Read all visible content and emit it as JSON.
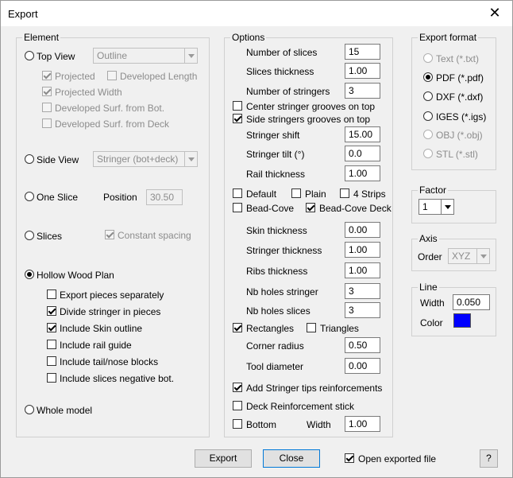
{
  "window": {
    "title": "Export",
    "close_glyph": "✕"
  },
  "element": {
    "legend": "Element",
    "top_view": {
      "label": "Top View",
      "selected": false,
      "combo_value": "Outline",
      "options": [
        {
          "label": "Projected",
          "checked": true
        },
        {
          "label": "Developed Length",
          "checked": false
        },
        {
          "label": "Projected Width",
          "checked": true
        },
        {
          "label": "Developed Surf. from Bot.",
          "checked": false
        },
        {
          "label": "Developed Surf. from Deck",
          "checked": false
        }
      ]
    },
    "side_view": {
      "label": "Side View",
      "selected": false,
      "combo_value": "Stringer (bot+deck)"
    },
    "one_slice": {
      "label": "One Slice",
      "selected": false,
      "position_label": "Position",
      "position_value": "30.50"
    },
    "slices": {
      "label": "Slices",
      "selected": false,
      "constant_spacing_label": "Constant spacing",
      "constant_spacing_checked": true
    },
    "hollow_wood_plan": {
      "label": "Hollow Wood Plan",
      "selected": true,
      "options": [
        {
          "label": "Export pieces separately",
          "checked": false
        },
        {
          "label": "Divide stringer in pieces",
          "checked": true
        },
        {
          "label": "Include Skin outline",
          "checked": true
        },
        {
          "label": "Include rail guide",
          "checked": false
        },
        {
          "label": "Include tail/nose blocks",
          "checked": false
        },
        {
          "label": "Include slices negative bot.",
          "checked": false
        }
      ]
    },
    "whole_model": {
      "label": "Whole model",
      "selected": false
    }
  },
  "options": {
    "legend": "Options",
    "number_of_slices": {
      "label": "Number of slices",
      "value": "15"
    },
    "slices_thickness": {
      "label": "Slices thickness",
      "value": "1.00"
    },
    "number_of_stringers": {
      "label": "Number of stringers",
      "value": "3"
    },
    "center_stringer_grooves": {
      "label": "Center stringer grooves on top",
      "checked": false
    },
    "side_stringers_grooves": {
      "label": "Side stringers grooves on top",
      "checked": true
    },
    "stringer_shift": {
      "label": "Stringer shift",
      "value": "15.00"
    },
    "stringer_tilt": {
      "label": "Stringer tilt (°)",
      "value": "0.0"
    },
    "rail_thickness": {
      "label": "Rail thickness",
      "value": "1.00"
    },
    "default": {
      "label": "Default",
      "checked": false
    },
    "plain": {
      "label": "Plain",
      "checked": false
    },
    "four_strips": {
      "label": "4 Strips",
      "checked": false
    },
    "bead_cove": {
      "label": "Bead-Cove",
      "checked": false
    },
    "bead_cove_deck": {
      "label": "Bead-Cove Deck",
      "checked": true
    },
    "skin_thickness": {
      "label": "Skin thickness",
      "value": "0.00"
    },
    "stringer_thickness": {
      "label": "Stringer thickness",
      "value": "1.00"
    },
    "ribs_thickness": {
      "label": "Ribs thickness",
      "value": "1.00"
    },
    "nb_holes_stringer": {
      "label": "Nb holes stringer",
      "value": "3"
    },
    "nb_holes_slices": {
      "label": "Nb holes slices",
      "value": "3"
    },
    "rectangles": {
      "label": "Rectangles",
      "checked": true
    },
    "triangles": {
      "label": "Triangles",
      "checked": false
    },
    "corner_radius": {
      "label": "Corner radius",
      "value": "0.50"
    },
    "tool_diameter": {
      "label": "Tool diameter",
      "value": "0.00"
    },
    "add_stringer_tips": {
      "label": "Add Stringer tips reinforcements",
      "checked": true
    },
    "deck_reinforcement": {
      "label": "Deck Reinforcement stick",
      "checked": false
    },
    "bottom": {
      "label": "Bottom",
      "checked": false,
      "width_label": "Width",
      "width_value": "1.00"
    }
  },
  "export_format": {
    "legend": "Export format",
    "items": [
      {
        "label": "Text (*.txt)",
        "selected": false,
        "enabled": false
      },
      {
        "label": "PDF (*.pdf)",
        "selected": true,
        "enabled": true
      },
      {
        "label": "DXF (*.dxf)",
        "selected": false,
        "enabled": true
      },
      {
        "label": "IGES (*.igs)",
        "selected": false,
        "enabled": true
      },
      {
        "label": "OBJ (*.obj)",
        "selected": false,
        "enabled": false
      },
      {
        "label": "STL (*.stl)",
        "selected": false,
        "enabled": false
      }
    ]
  },
  "factor": {
    "legend": "Factor",
    "value": "1"
  },
  "axis": {
    "legend": "Axis",
    "order_label": "Order",
    "order_value": "XYZ"
  },
  "line": {
    "legend": "Line",
    "width_label": "Width",
    "width_value": "0.050",
    "color_label": "Color",
    "color": "#0000ff"
  },
  "footer": {
    "export_label": "Export",
    "close_label": "Close",
    "open_exported_label": "Open exported file",
    "open_exported_checked": true,
    "help_label": "?"
  }
}
